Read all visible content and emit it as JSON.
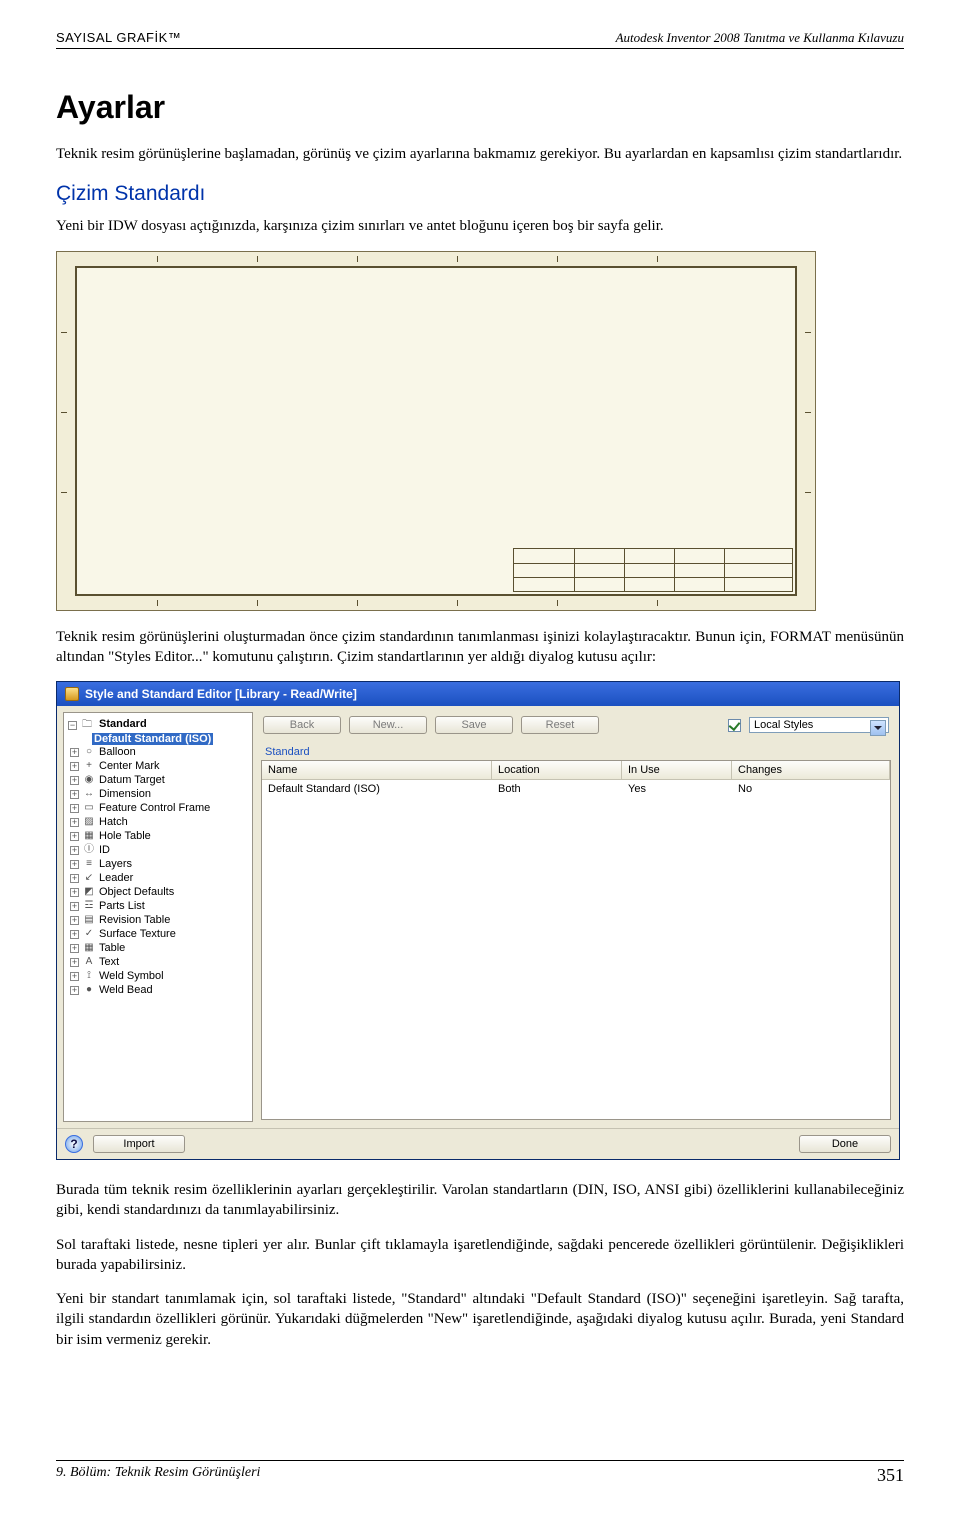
{
  "header": {
    "left": "SAYISAL GRAFİK™",
    "right": "Autodesk Inventor 2008 Tanıtma ve Kullanma Kılavuzu"
  },
  "title": "Ayarlar",
  "para1": "Teknik resim görünüşlerine başlamadan, görünüş ve çizim ayarlarına bakmamız gerekiyor. Bu ayarlardan en kapsamlısı çizim standartlarıdır.",
  "subhead": "Çizim Standardı",
  "para2": "Yeni bir IDW dosyası açtığınızda, karşınıza çizim sınırları ve antet bloğunu içeren boş bir sayfa gelir.",
  "para3": "Teknik resim görünüşlerini oluşturmadan önce çizim standardının tanımlanması işinizi kolaylaştıracaktır. Bunun için, FORMAT menüsünün altından \"Styles Editor...\" komutunu çalıştırın. Çizim standartlarının yer aldığı diyalog kutusu açılır:",
  "dialog": {
    "title": "Style and Standard Editor [Library - Read/Write]",
    "toolbar": {
      "back": "Back",
      "new": "New...",
      "save": "Save",
      "reset": "Reset",
      "filter_value": "Local Styles"
    },
    "tree": {
      "root": "Standard",
      "selected": "Default Standard (ISO)",
      "items": [
        {
          "icon": "○",
          "label": "Balloon"
        },
        {
          "icon": "+",
          "label": "Center Mark"
        },
        {
          "icon": "◉",
          "label": "Datum Target"
        },
        {
          "icon": "↔",
          "label": "Dimension"
        },
        {
          "icon": "▭",
          "label": "Feature Control Frame"
        },
        {
          "icon": "▨",
          "label": "Hatch"
        },
        {
          "icon": "▦",
          "label": "Hole Table"
        },
        {
          "icon": "Ⓘ",
          "label": "ID"
        },
        {
          "icon": "≡",
          "label": "Layers"
        },
        {
          "icon": "↙",
          "label": "Leader"
        },
        {
          "icon": "◩",
          "label": "Object Defaults"
        },
        {
          "icon": "☲",
          "label": "Parts List"
        },
        {
          "icon": "▤",
          "label": "Revision Table"
        },
        {
          "icon": "✓",
          "label": "Surface Texture"
        },
        {
          "icon": "▦",
          "label": "Table"
        },
        {
          "icon": "A",
          "label": "Text"
        },
        {
          "icon": "⟟",
          "label": "Weld Symbol"
        },
        {
          "icon": "●",
          "label": "Weld Bead"
        }
      ]
    },
    "panel": {
      "group": "Standard",
      "columns": {
        "c1": "Name",
        "c2": "Location",
        "c3": "In Use",
        "c4": "Changes"
      },
      "row": {
        "c1": "Default Standard (ISO)",
        "c2": "Both",
        "c3": "Yes",
        "c4": "No"
      }
    },
    "footer": {
      "import": "Import",
      "done": "Done",
      "help": "?"
    }
  },
  "para4": "Burada tüm teknik resim özelliklerinin ayarları gerçekleştirilir. Varolan standartların (DIN, ISO, ANSI gibi) özelliklerini kullanabileceğiniz gibi, kendi standardınızı da tanımlayabilirsiniz.",
  "para5": "Sol taraftaki listede, nesne tipleri yer alır. Bunlar çift tıklamayla işaretlendiğinde, sağdaki pencerede özellikleri görüntülenir. Değişiklikleri burada yapabilirsiniz.",
  "para6": "Yeni bir standart tanımlamak için, sol taraftaki listede, \"Standard\" altındaki \"Default Standard (ISO)\" seçeneğini işaretleyin. Sağ tarafta, ilgili standardın özellikleri görünür. Yukarıdaki düğmelerden \"New\" işaretlendiğinde, aşağıdaki diyalog kutusu açılır. Burada, yeni Standard bir isim vermeniz gerekir.",
  "footer": {
    "left": "9. Bölüm: Teknik Resim Görünüşleri",
    "page": "351"
  }
}
